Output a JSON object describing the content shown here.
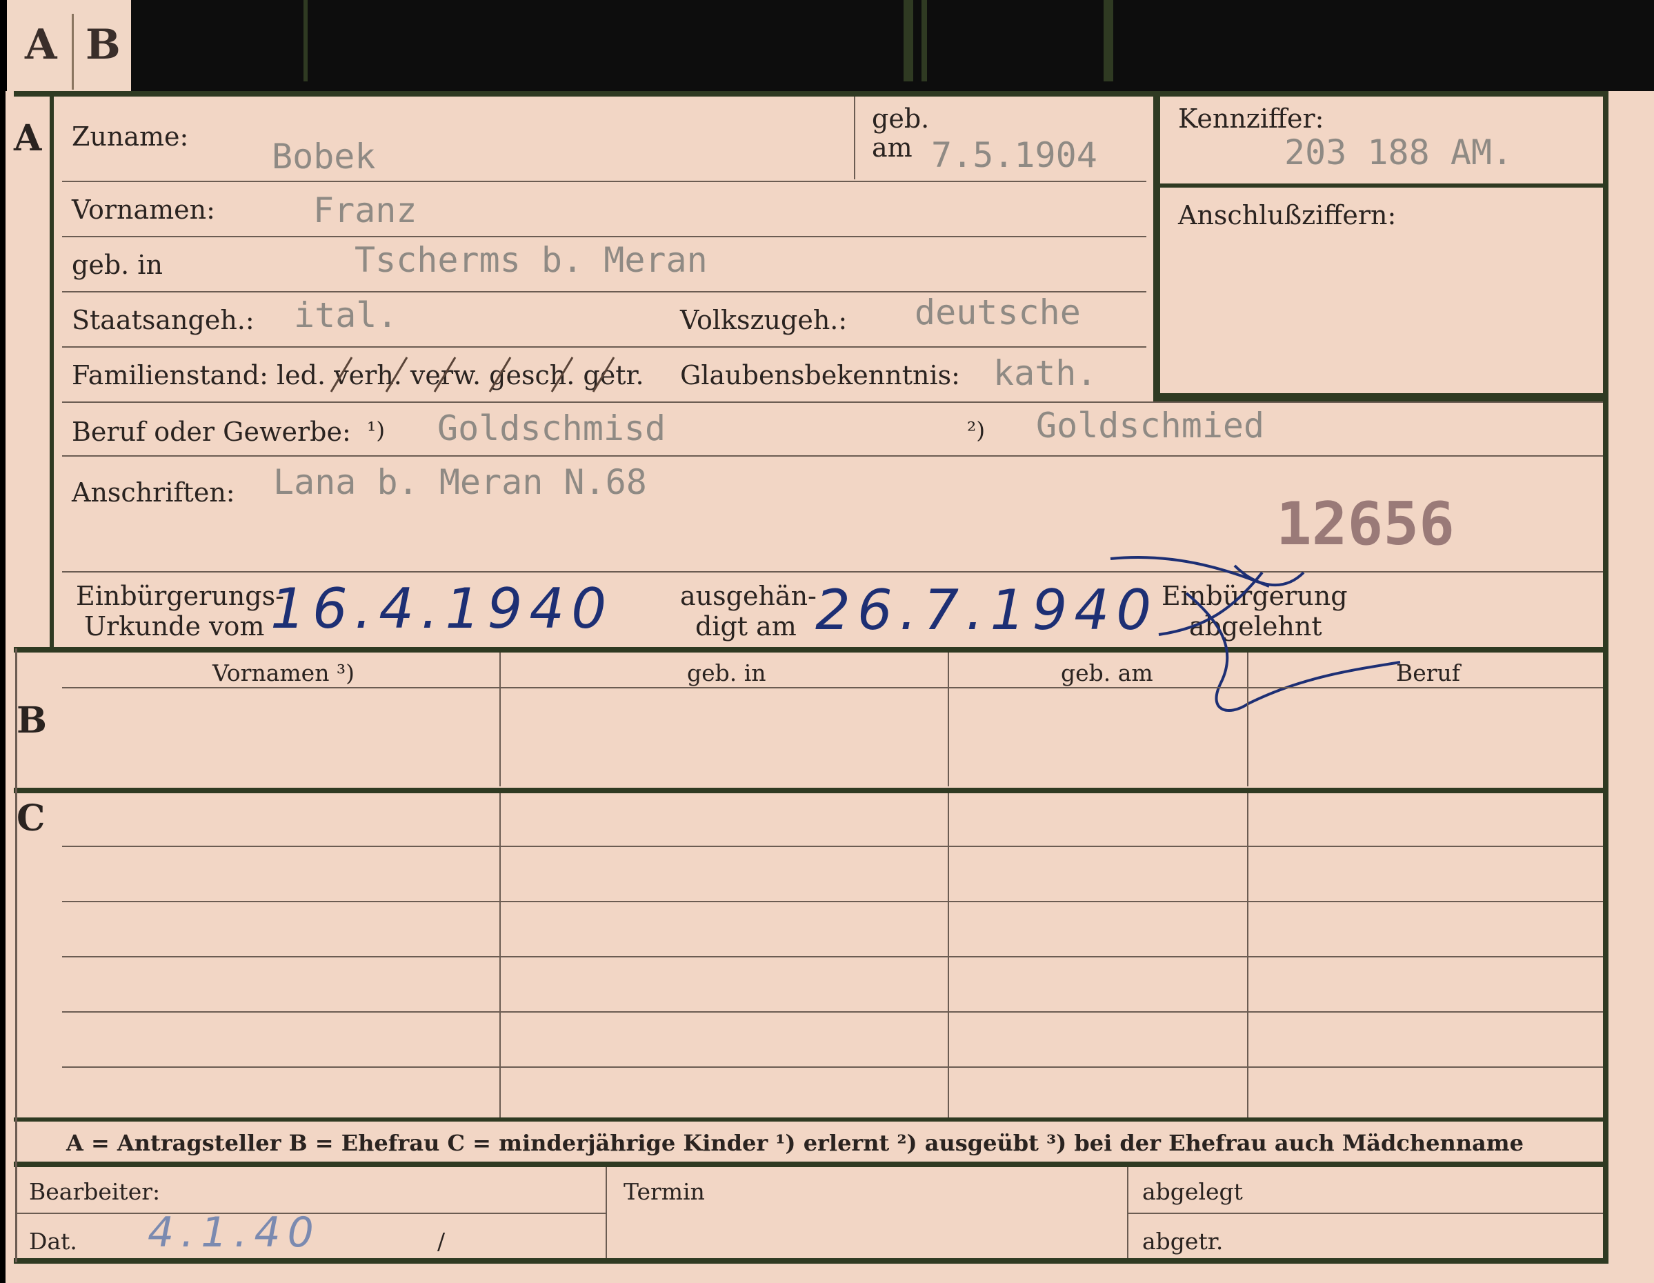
{
  "tabs": {
    "a": "A",
    "b": "B"
  },
  "section_markers": {
    "a": "A",
    "b": "B",
    "c": "C"
  },
  "labels": {
    "zuname": "Zuname:",
    "geb": "geb.",
    "am": "am",
    "kennziffer": "Kennziffer:",
    "anschlussziffern": "Anschlußziffern:",
    "vornamen": "Vornamen:",
    "geb_in": "geb. in",
    "staatsangeh": "Staatsangeh.:",
    "volkszugeh": "Volkszugeh.:",
    "familienstand": "Familienstand: led. verh. verw. gesch. getr.",
    "glaubensbekenntnis": "Glaubensbekenntnis:",
    "beruf": "Beruf oder Gewerbe:",
    "beruf_ref1": "¹)",
    "beruf_ref2": "²)",
    "anschriften": "Anschriften:",
    "einb_line1": "Einbürgerungs-",
    "einb_line2": "Urkunde vom",
    "ausgeh_line1": "ausgehän-",
    "ausgeh_line2": "digt am",
    "abgelehnt_line1": "Einbürgerung",
    "abgelehnt_line2": "abgelehnt",
    "bearbeiter": "Bearbeiter:",
    "termin": "Termin",
    "abgelegt": "abgelegt",
    "dat": "Dat.",
    "dat_slash": "/",
    "abgetr": "abgetr."
  },
  "table_headers": [
    "Vornamen ³)",
    "geb. in",
    "geb. am",
    "Beruf"
  ],
  "legend": "A = Antragsteller   B = Ehefrau   C = minderjährige Kinder   ¹) erlernt   ²) ausgeübt   ³) bei der Ehefrau auch Mädchenname",
  "values": {
    "zuname": "Bobek",
    "geb_am": "7.5.1904",
    "kennziffer": "203 188 AM.",
    "vornamen": "Franz",
    "geb_in": "Tscherms b. Meran",
    "staatsangeh": "ital.",
    "volkszugeh": "deutsche",
    "glaubensbekenntnis": "kath.",
    "beruf_erlernt": "Goldschmisd",
    "beruf_ausgeuebt": "Goldschmied",
    "anschriften": "Lana b. Meran N.68",
    "stamp_number": "12656",
    "urkunde_vom": "16.4.1940",
    "ausgehaendigt_am": "26.7.1940",
    "dat": "4.1.40"
  },
  "colors": {
    "card": "#f2d6c5",
    "frame": "#2f3a22",
    "ink": "#1d2f74",
    "typed": "#8f8a84"
  }
}
